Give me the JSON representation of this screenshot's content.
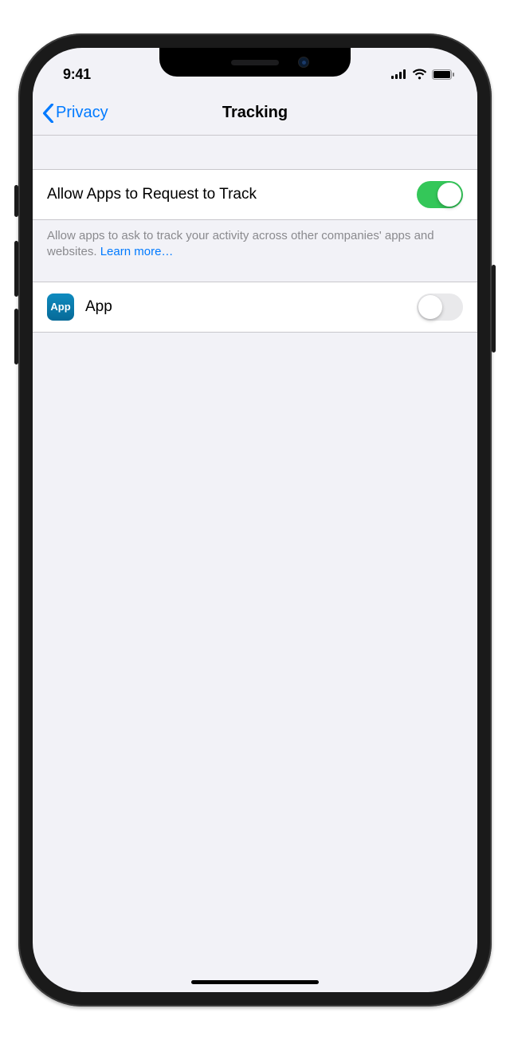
{
  "status": {
    "time": "9:41"
  },
  "nav": {
    "back_label": "Privacy",
    "title": "Tracking"
  },
  "main": {
    "allow_label": "Allow Apps to Request to Track",
    "allow_toggle_on": true,
    "footer_text": "Allow apps to ask to track your activity across other companies' apps and websites. ",
    "learn_more": "Learn more…"
  },
  "apps": [
    {
      "name": "App",
      "icon_text": "App",
      "toggle_on": false
    }
  ]
}
